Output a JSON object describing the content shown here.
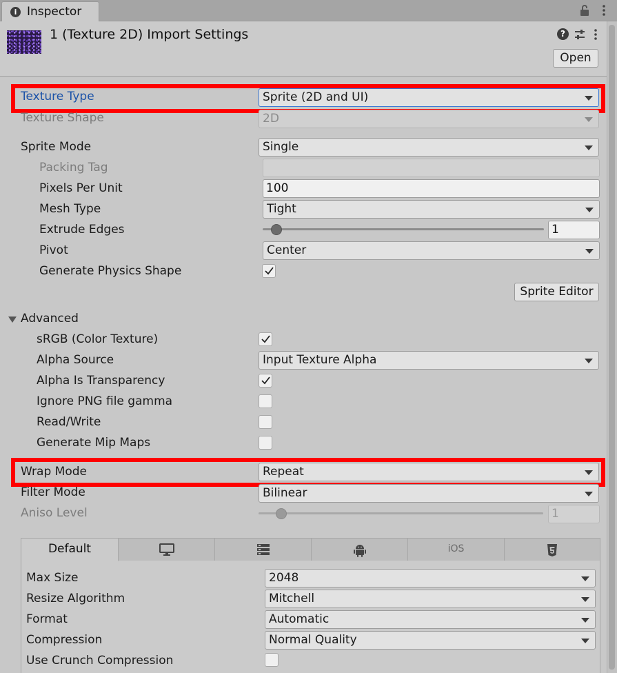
{
  "window": {
    "tab_label": "Inspector"
  },
  "header": {
    "title": "1 (Texture 2D) Import Settings",
    "open_label": "Open"
  },
  "fields": {
    "texture_type": {
      "label": "Texture Type",
      "value": "Sprite (2D and UI)"
    },
    "texture_shape": {
      "label": "Texture Shape",
      "value": "2D"
    },
    "sprite_mode": {
      "label": "Sprite Mode",
      "value": "Single"
    },
    "packing_tag": {
      "label": "Packing Tag",
      "value": ""
    },
    "pixels_per_unit": {
      "label": "Pixels Per Unit",
      "value": "100"
    },
    "mesh_type": {
      "label": "Mesh Type",
      "value": "Tight"
    },
    "extrude_edges": {
      "label": "Extrude Edges",
      "value": "1",
      "slider_fraction": 0.05
    },
    "pivot": {
      "label": "Pivot",
      "value": "Center"
    },
    "generate_physics_shape": {
      "label": "Generate Physics Shape",
      "checked": true
    },
    "sprite_editor_label": "Sprite Editor"
  },
  "advanced": {
    "label": "Advanced",
    "expanded": true,
    "srgb": {
      "label": "sRGB (Color Texture)",
      "checked": true
    },
    "alpha_source": {
      "label": "Alpha Source",
      "value": "Input Texture Alpha"
    },
    "alpha_is_transparency": {
      "label": "Alpha Is Transparency",
      "checked": true
    },
    "ignore_png_gamma": {
      "label": "Ignore PNG file gamma",
      "checked": false
    },
    "read_write": {
      "label": "Read/Write",
      "checked": false
    },
    "generate_mip_maps": {
      "label": "Generate Mip Maps",
      "checked": false
    }
  },
  "wrap": {
    "wrap_mode": {
      "label": "Wrap Mode",
      "value": "Repeat"
    },
    "filter_mode": {
      "label": "Filter Mode",
      "value": "Bilinear"
    },
    "aniso_level": {
      "label": "Aniso Level",
      "value": "1",
      "slider_fraction": 0.08
    }
  },
  "platforms": {
    "tabs": [
      {
        "label": "Default",
        "icon": "none",
        "active": true
      },
      {
        "label": "",
        "icon": "monitor-icon",
        "active": false
      },
      {
        "label": "",
        "icon": "server-icon",
        "active": false
      },
      {
        "label": "",
        "icon": "android-icon",
        "active": false
      },
      {
        "label": "iOS",
        "icon": "none",
        "active": false
      },
      {
        "label": "",
        "icon": "html5-icon",
        "active": false
      }
    ],
    "max_size": {
      "label": "Max Size",
      "value": "2048"
    },
    "resize_algorithm": {
      "label": "Resize Algorithm",
      "value": "Mitchell"
    },
    "format": {
      "label": "Format",
      "value": "Automatic"
    },
    "compression": {
      "label": "Compression",
      "value": "Normal Quality"
    },
    "use_crunch": {
      "label": "Use Crunch Compression",
      "checked": false
    }
  },
  "colors": {
    "highlight": "#ff0000",
    "label_focus": "#1c53a8",
    "panel_bg": "#c8c8c8"
  }
}
